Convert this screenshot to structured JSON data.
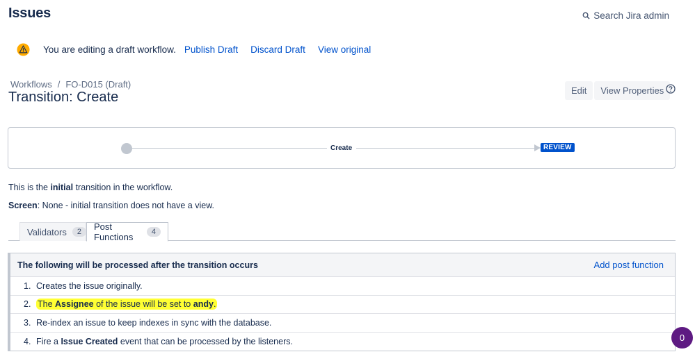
{
  "header": {
    "title": "Issues",
    "search_label": "Search Jira admin"
  },
  "draft_banner": {
    "message": "You are editing a draft workflow.",
    "publish": "Publish Draft",
    "discard": "Discard Draft",
    "view_original": "View original"
  },
  "breadcrumb": {
    "workflows": "Workflows",
    "separator": "/",
    "current": "FO-D015 (Draft)"
  },
  "page_title": "Transition: Create",
  "actions": {
    "edit": "Edit",
    "view_properties": "View Properties"
  },
  "diagram": {
    "transition": "Create",
    "target_status": "REVIEW"
  },
  "info": {
    "initial_prefix": "This is the ",
    "initial_bold": "initial",
    "initial_suffix": " transition in the workflow.",
    "screen_label": "Screen",
    "screen_text": ": None - initial transition does not have a view."
  },
  "tabs": [
    {
      "label": "Validators",
      "count": "2"
    },
    {
      "label": "Post Functions",
      "count": "4"
    }
  ],
  "post_functions": {
    "header": "The following will be processed after the transition occurs",
    "add": "Add post function",
    "items": [
      {
        "num": "1.",
        "text": "Creates the issue originally."
      },
      {
        "num": "2.",
        "pre": "The ",
        "bold1": "Assignee",
        "mid": " of the issue will be set to ",
        "bold2": "andy",
        "post": "."
      },
      {
        "num": "3.",
        "text": "Re-index an issue to keep indexes in sync with the database."
      },
      {
        "num": "4.",
        "pre": "Fire a ",
        "bold1": "Issue Created",
        "post": " event that can be processed by the listeners."
      }
    ]
  },
  "fab": {
    "count": "0"
  },
  "colors": {
    "link": "#0052cc",
    "lozenge": "#0052cc",
    "highlight": "#ffff33",
    "fab": "#5e1a82"
  }
}
